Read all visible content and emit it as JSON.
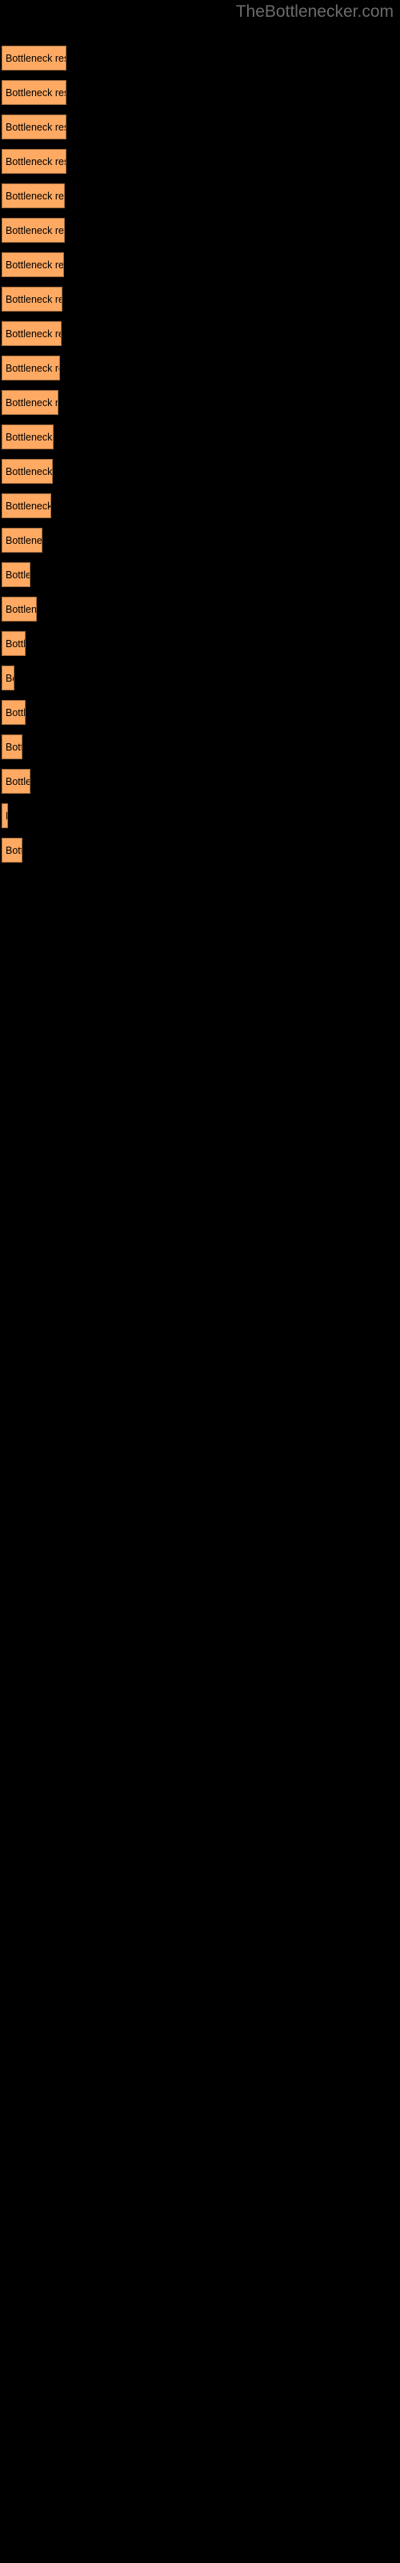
{
  "watermark": "TheBottlenecker.com",
  "background_color": "#000000",
  "bar_color": "#ffa962",
  "bar_border_color": "#a8703f",
  "label_color": "#000000",
  "watermark_color": "#6b6b6b",
  "chart_data": {
    "type": "bar",
    "orientation": "horizontal",
    "title": "",
    "subtitle": "",
    "xlabel": "",
    "ylabel": "",
    "grid": false,
    "legend": null,
    "annotations": [
      "TheBottlenecker.com"
    ],
    "categories": [
      "",
      "",
      "",
      "",
      "",
      "",
      "",
      "",
      "",
      "",
      "",
      "",
      "",
      "",
      "",
      "",
      "",
      "",
      "",
      "",
      "",
      "",
      ""
    ],
    "bar_label_text": "Bottleneck result",
    "values": [
      81,
      81,
      81,
      81,
      79,
      79,
      78,
      76,
      75,
      73,
      71,
      65,
      64,
      62,
      51,
      43,
      44,
      33,
      20,
      33,
      28,
      37,
      12,
      27
    ],
    "xlim": [
      0,
      500
    ],
    "bars": [
      {
        "y": 57,
        "width": 81,
        "label": "Bottleneck result"
      },
      {
        "y": 100,
        "width": 81,
        "label": "Bottleneck result"
      },
      {
        "y": 143,
        "width": 81,
        "label": "Bottleneck result"
      },
      {
        "y": 186,
        "width": 81,
        "label": "Bottleneck result"
      },
      {
        "y": 229,
        "width": 79,
        "label": "Bottleneck result"
      },
      {
        "y": 272,
        "width": 79,
        "label": "Bottleneck result"
      },
      {
        "y": 315,
        "width": 78,
        "label": "Bottleneck result"
      },
      {
        "y": 358,
        "width": 76,
        "label": "Bottleneck result"
      },
      {
        "y": 401,
        "width": 75,
        "label": "Bottleneck result"
      },
      {
        "y": 444,
        "width": 73,
        "label": "Bottleneck result"
      },
      {
        "y": 487,
        "width": 71,
        "label": "Bottleneck result"
      },
      {
        "y": 530,
        "width": 65,
        "label": "Bottleneck result"
      },
      {
        "y": 573,
        "width": 64,
        "label": "Bottleneck result"
      },
      {
        "y": 616,
        "width": 62,
        "label": "Bottleneck result"
      },
      {
        "y": 659,
        "width": 51,
        "label": "Bottleneck result"
      },
      {
        "y": 702,
        "width": 36,
        "label": "Bottleneck result"
      },
      {
        "y": 745,
        "width": 44,
        "label": "Bottleneck result"
      },
      {
        "y": 788,
        "width": 30,
        "label": "Bottleneck result"
      },
      {
        "y": 831,
        "width": 16,
        "label": "Bottleneck result"
      },
      {
        "y": 874,
        "width": 30,
        "label": "Bottleneck result"
      },
      {
        "y": 917,
        "width": 26,
        "label": "Bottleneck result"
      },
      {
        "y": 960,
        "width": 36,
        "label": "Bottleneck result"
      },
      {
        "y": 1003,
        "width": 8,
        "label": "Bottleneck result"
      },
      {
        "y": 1046,
        "width": 26,
        "label": "Bottleneck result"
      }
    ]
  }
}
